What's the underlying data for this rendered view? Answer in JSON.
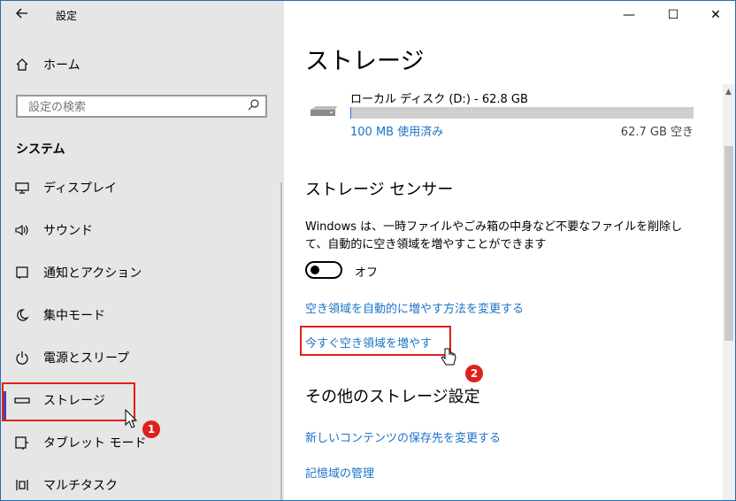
{
  "window": {
    "title": "設定",
    "back_icon": "arrow-left-icon",
    "controls": [
      "—",
      "☐",
      "✕"
    ]
  },
  "sidebar": {
    "home": {
      "label": "ホーム",
      "icon": "home-icon"
    },
    "search": {
      "placeholder": "設定の検索",
      "icon": "search-icon"
    },
    "section_header": "システム",
    "items": [
      {
        "label": "ディスプレイ",
        "icon": "monitor-icon"
      },
      {
        "label": "サウンド",
        "icon": "speaker-icon"
      },
      {
        "label": "通知とアクション",
        "icon": "notification-icon"
      },
      {
        "label": "集中モード",
        "icon": "moon-icon"
      },
      {
        "label": "電源とスリープ",
        "icon": "power-icon"
      },
      {
        "label": "ストレージ",
        "icon": "storage-icon",
        "selected": true
      },
      {
        "label": "タブレット モード",
        "icon": "tablet-icon"
      },
      {
        "label": "マルチタスク",
        "icon": "multitask-icon"
      }
    ]
  },
  "annotations": {
    "badge1": "1",
    "badge2": "2",
    "highlight_color": "#e0201b"
  },
  "main": {
    "title": "ストレージ",
    "disk": {
      "name": "ローカル ディスク (D:) - 62.8 GB",
      "used": "100 MB 使用済み",
      "free": "62.7 GB 空き",
      "used_fraction": 0.0016,
      "icon": "drive-icon"
    },
    "sensor": {
      "heading": "ストレージ センサー",
      "description": "Windows は、一時ファイルやごみ箱の中身など不要なファイルを削除して、自動的に空き領域を増やすことができます",
      "toggle_label": "オフ",
      "toggle_on": false,
      "link_change": "空き領域を自動的に増やす方法を変更する",
      "link_free_now": "今すぐ空き領域を増やす"
    },
    "other": {
      "heading": "その他のストレージ設定",
      "link_save_location": "新しいコンテンツの保存先を変更する",
      "link_manage_spaces": "記憶域の管理"
    }
  },
  "colors": {
    "accent": "#1a73c7",
    "selected_indicator": "#4b3fb0",
    "sidebar_bg": "#e6e6e6"
  }
}
